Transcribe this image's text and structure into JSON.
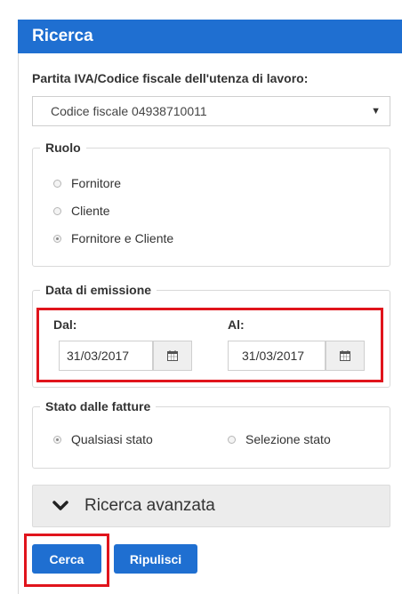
{
  "panel": {
    "title": "Ricerca"
  },
  "piva": {
    "label": "Partita IVA/Codice fiscale dell'utenza di lavoro:",
    "selected": "Codice fiscale 04938710011"
  },
  "ruolo": {
    "legend": "Ruolo",
    "options": [
      "Fornitore",
      "Cliente",
      "Fornitore e Cliente"
    ],
    "selected_index": 2
  },
  "data_emissione": {
    "legend": "Data di emissione",
    "from_label": "Dal:",
    "from_value": "31/03/2017",
    "to_label": "Al:",
    "to_value": "31/03/2017"
  },
  "stato": {
    "legend": "Stato dalle fatture",
    "options": [
      "Qualsiasi stato",
      "Selezione stato"
    ],
    "selected_index": 0
  },
  "advanced": {
    "label": "Ricerca avanzata"
  },
  "buttons": {
    "search": "Cerca",
    "reset": "Ripulisci"
  },
  "colors": {
    "primary": "#1f6fd1",
    "highlight": "#e0141c"
  }
}
